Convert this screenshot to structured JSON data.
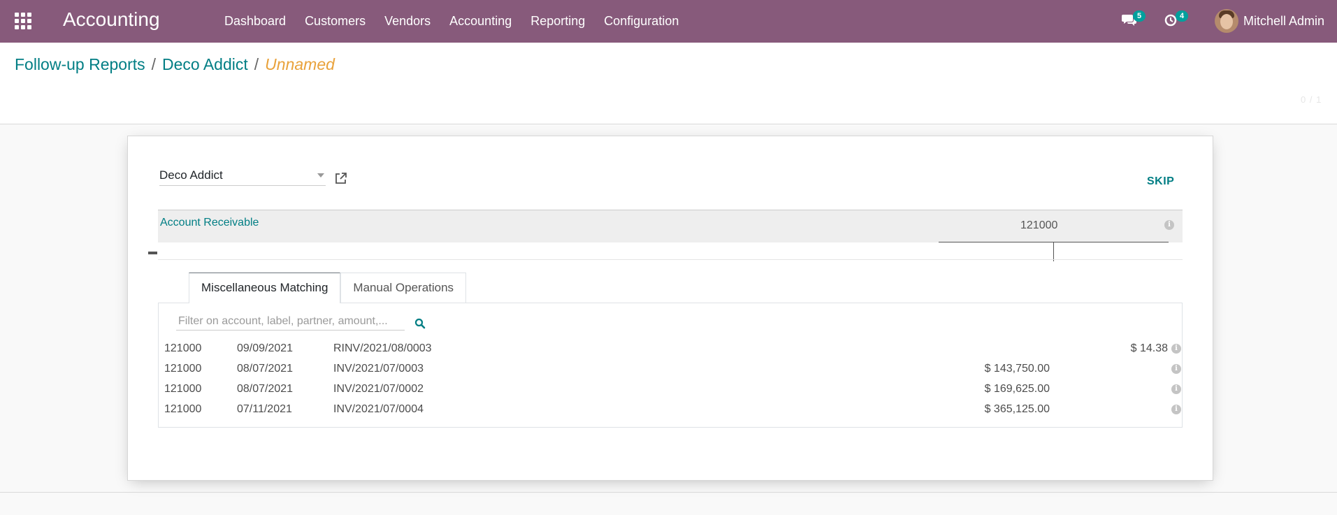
{
  "navbar": {
    "app_name": "Accounting",
    "menu": [
      "Dashboard",
      "Customers",
      "Vendors",
      "Accounting",
      "Reporting",
      "Configuration"
    ],
    "messages_count": "5",
    "activities_count": "4",
    "user_name": "Mitchell Admin"
  },
  "breadcrumb": {
    "items": [
      "Follow-up Reports",
      "Deco Addict"
    ],
    "current": "Unnamed"
  },
  "pager": "0 / 1",
  "form": {
    "partner": "Deco Addict",
    "skip_label": "SKIP",
    "account_receivable": {
      "name": "Account Receivable",
      "code": "121000"
    },
    "tabs": [
      "Miscellaneous Matching",
      "Manual Operations"
    ],
    "active_tab": "Miscellaneous Matching",
    "filter_placeholder": "Filter on account, label, partner, amount,...",
    "lines": [
      {
        "account": "121000",
        "date": "09/09/2021",
        "label": "RINV/2021/08/0003",
        "debit": "",
        "credit": "$ 14.38"
      },
      {
        "account": "121000",
        "date": "08/07/2021",
        "label": "INV/2021/07/0003",
        "debit": "$ 143,750.00",
        "credit": ""
      },
      {
        "account": "121000",
        "date": "08/07/2021",
        "label": "INV/2021/07/0002",
        "debit": "$ 169,625.00",
        "credit": ""
      },
      {
        "account": "121000",
        "date": "07/11/2021",
        "label": "INV/2021/07/0004",
        "debit": "$ 365,125.00",
        "credit": ""
      }
    ]
  },
  "icons": {
    "apps": "apps-grid-icon",
    "messages": "chat-bubbles-icon",
    "activities": "clock-icon",
    "external": "external-link-icon",
    "search": "search-icon",
    "info": "info-icon"
  },
  "colors": {
    "navbar": "#875a7b",
    "link": "#017e84",
    "current_crumb": "#e9a23b",
    "badge": "#00a09d"
  }
}
